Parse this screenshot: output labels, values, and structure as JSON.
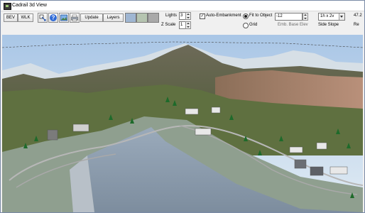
{
  "window": {
    "title": "Cadrail 3d View"
  },
  "toolbar": {
    "bev_label": "BEV",
    "wlk_label": "WLK",
    "update_label": "Update",
    "layers_label": "Layers",
    "swatch_colors": [
      "#9fb6d2",
      "#b5c4b0",
      "#a9a9a9"
    ],
    "lights_label": "Lights",
    "lights_value": "3",
    "zscale_label": "Z Scale",
    "zscale_value": "1",
    "auto_embankment_label": "Auto-Embankment",
    "auto_embankment_checked": true,
    "fit_to_object_label": "Fit to Object",
    "grid_label": "Grid",
    "emb_base_elev_value": "-12",
    "emb_base_elev_label": "Emb. Base Elev",
    "side_slope_value": "1h x 2v",
    "side_slope_label": "Side Slope",
    "cut_value": "47.2",
    "cut_label": "Re"
  },
  "viewport": {
    "description_icon": "3d-layout-scene",
    "sky_color": "#c8d9ea",
    "base_color": "#8a9aa9"
  }
}
